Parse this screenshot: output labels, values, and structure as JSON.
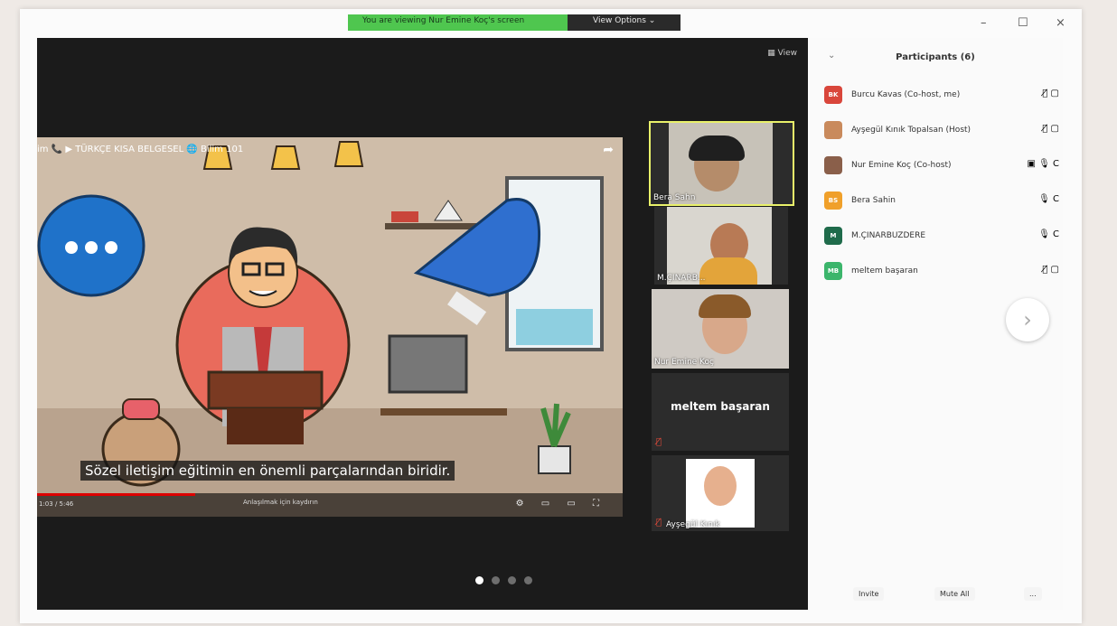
{
  "banner": {
    "message": "You are viewing Nur Emine Koç's screen",
    "options": "View Options ⌄"
  },
  "window": {
    "minimize": "–",
    "maximize": "☐",
    "close": "×"
  },
  "stage": {
    "view_label": "▦ View",
    "video": {
      "title": "im 📞 ▶ TÜRKÇE KISA BELGESEL 🌐 Bilim 101",
      "subtitle": "Sözel iletişim eğitimin en önemli parçalarından biridir.",
      "time": "1:03 / 5:46",
      "chapter": "Anlaşılmak için kaydırın",
      "progress": 0.27
    },
    "thumbnails": [
      {
        "label": "Bera Sahn"
      },
      {
        "label": "M.ÇINARB..."
      },
      {
        "label": "Nur Emine Koç"
      },
      {
        "label": "meltem başaran"
      },
      {
        "label": "Ayşegül Kınık"
      }
    ],
    "page_dots": 4,
    "active_dot": 1
  },
  "panel": {
    "title": "Participants (6)",
    "collapse": "⌄",
    "participants": [
      {
        "initials": "BK",
        "name": "Burcu Kavas (Co-host, me)",
        "color": "#d9463b",
        "icons": "🎙̸ ▢"
      },
      {
        "initials": "",
        "name": "Ayşegül Kınık Topalsan (Host)",
        "color": "#c98a5c",
        "icons": "🎙̸ ▢"
      },
      {
        "initials": "",
        "name": "Nur Emine Koç (Co-host)",
        "color": "#8a5f4a",
        "icons": "▣ 🎙 C"
      },
      {
        "initials": "BS",
        "name": "Bera Sahin",
        "color": "#f0a02a",
        "icons": "🎙 C"
      },
      {
        "initials": "M",
        "name": "M.ÇINARBUZDERE",
        "color": "#1f6b4b",
        "icons": "🎙 C"
      },
      {
        "initials": "MB",
        "name": "meltem başaran",
        "color": "#3bb56b",
        "icons": "🎙̸ ▢"
      }
    ],
    "next_label": "›",
    "buttons": {
      "invite": "Invite",
      "mute_all": "Mute All",
      "more": "..."
    }
  },
  "colors": {
    "banner_green": "#4fc64f",
    "stage_bg": "#1b1b1b",
    "active_speaker": "#e9f16a",
    "muted_red": "#e04a3a"
  }
}
